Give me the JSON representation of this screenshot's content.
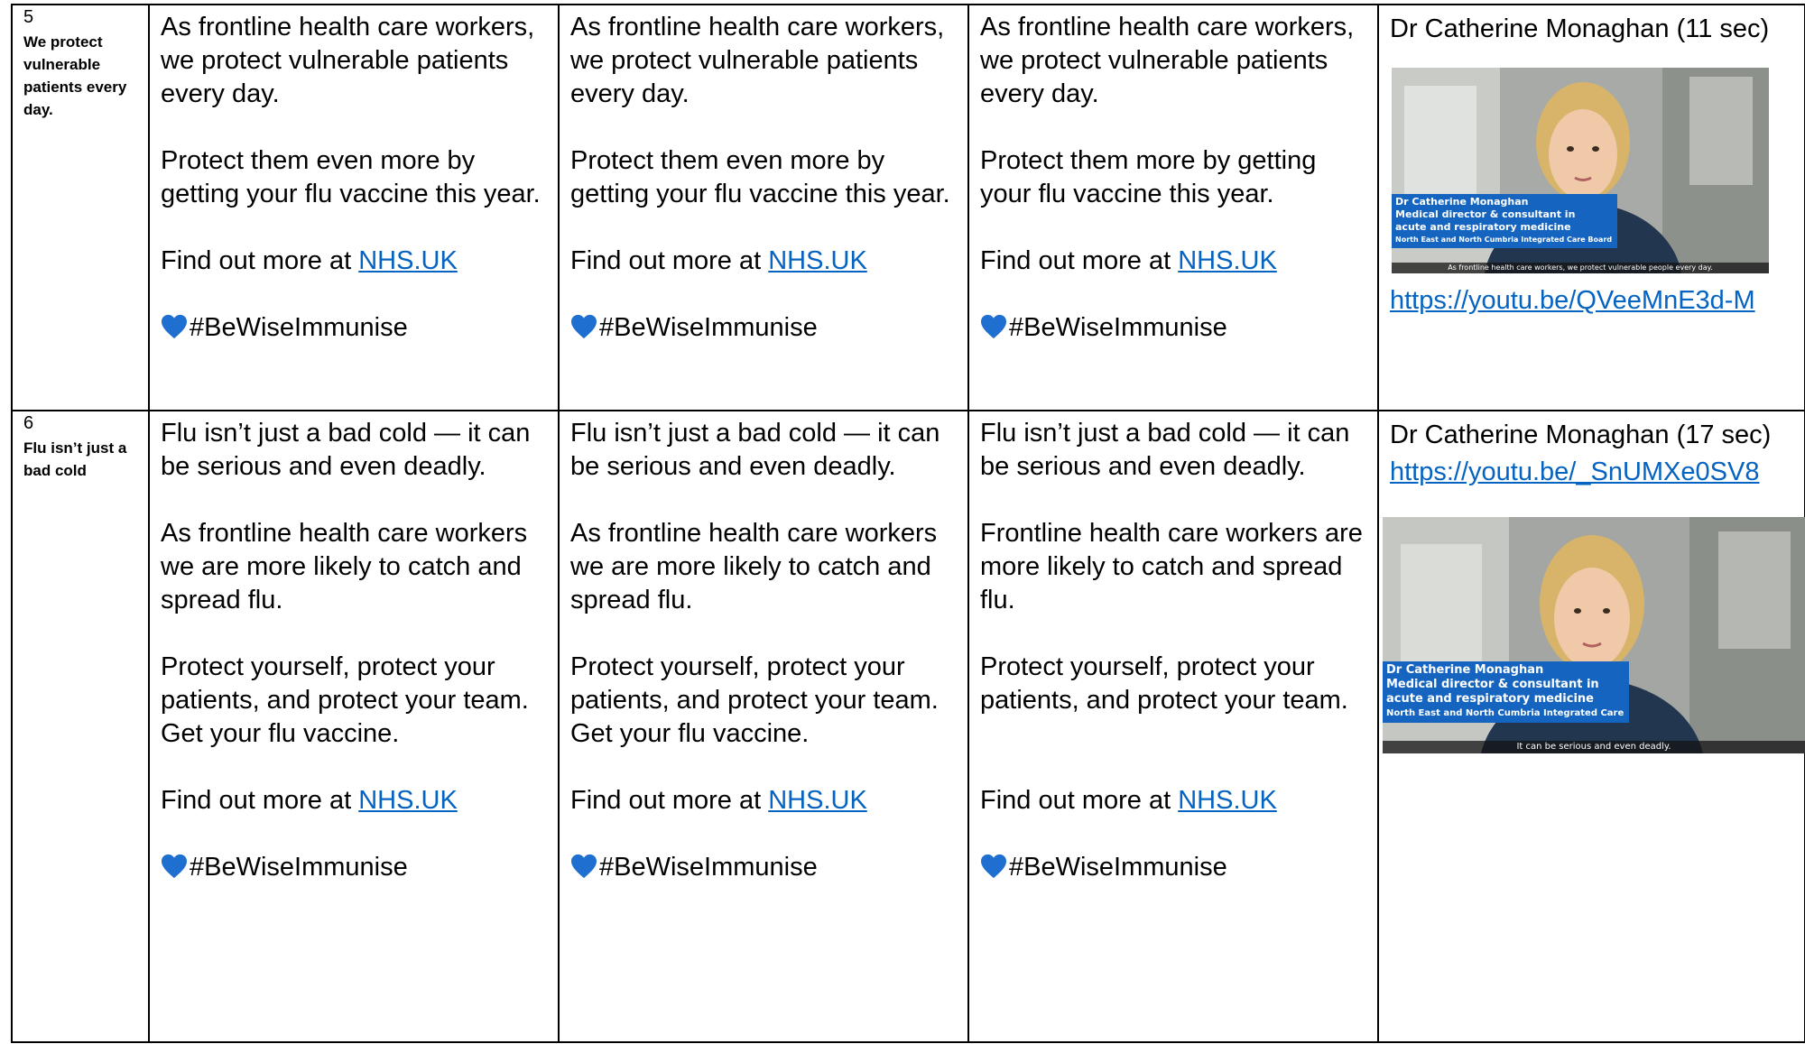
{
  "rows": [
    {
      "number": "5",
      "topic": "We protect vulnerable patients every day.",
      "col1": {
        "p1": "As frontline health care workers, we protect vulnerable patients every day.",
        "p2": "Protect them even more by getting your flu vaccine this year.",
        "find_prefix": "Find out more at ",
        "find_link": "NHS.UK",
        "hashtag": "#BeWiseImmunise"
      },
      "col2": {
        "p1": "As frontline health care workers, we protect vulnerable patients every day.",
        "p2": "Protect them even more by getting your flu vaccine this year.",
        "find_prefix": "Find out more at ",
        "find_link": "NHS.UK",
        "hashtag": "#BeWiseImmunise"
      },
      "col3": {
        "p1": "As frontline health care workers, we protect vulnerable patients every day.",
        "p2": "Protect them more by getting your flu vaccine this year.",
        "find_prefix": "Find out more at ",
        "find_link": "NHS.UK",
        "hashtag": "#BeWiseImmunise"
      },
      "media": {
        "caption": "Dr Catherine Monaghan (11 sec)",
        "url": "https://youtu.be/QVeeMnE3d-M",
        "thumb": {
          "name": "Dr Catherine Monaghan",
          "role": "Medical director & consultant in",
          "role2": "acute and respiratory medicine",
          "org": "North East and North Cumbria Integrated Care Board",
          "subtitle": "As frontline health care workers, we protect vulnerable people every day."
        }
      }
    },
    {
      "number": "6",
      "topic": "Flu isn’t just a bad cold",
      "col1": {
        "p1": "Flu isn’t just a bad cold — it can be serious and even deadly.",
        "p2": "As frontline health care workers we are more likely to catch and spread flu.",
        "p3": "Protect yourself, protect your patients, and protect your team.",
        "p4": "Get your flu vaccine.",
        "find_prefix": "Find out more at ",
        "find_link": "NHS.UK",
        "hashtag": "#BeWiseImmunise"
      },
      "col2": {
        "p1": "Flu isn’t just a bad cold — it can be serious and even deadly.",
        "p2": "As frontline health care workers we are more likely to catch and spread flu.",
        "p3": "Protect yourself, protect your patients, and protect your team.",
        "p4": "Get your flu vaccine.",
        "find_prefix": "Find out more at ",
        "find_link": "NHS.UK",
        "hashtag": "#BeWiseImmunise"
      },
      "col3": {
        "p1": "Flu isn’t just a bad cold — it can be serious and even deadly.",
        "p2": "Frontline health care workers are more likely to catch and spread flu.",
        "p3": "Protect yourself, protect your patients, and protect your team.",
        "find_prefix": "Find out more at ",
        "find_link": "NHS.UK",
        "hashtag": "#BeWiseImmunise"
      },
      "media": {
        "caption": "Dr Catherine Monaghan (17 sec)",
        "url": "https://youtu.be/_SnUMXe0SV8",
        "thumb": {
          "name": "Dr Catherine Monaghan",
          "role": "Medical director & consultant in",
          "role2": "acute and respiratory medicine",
          "org": "North East and North Cumbria Integrated Care",
          "subtitle": "It can be serious and even deadly."
        }
      }
    }
  ],
  "colors": {
    "link": "#0563c1",
    "heart": "#1e6fd0",
    "lower_third": "#1565c0"
  }
}
